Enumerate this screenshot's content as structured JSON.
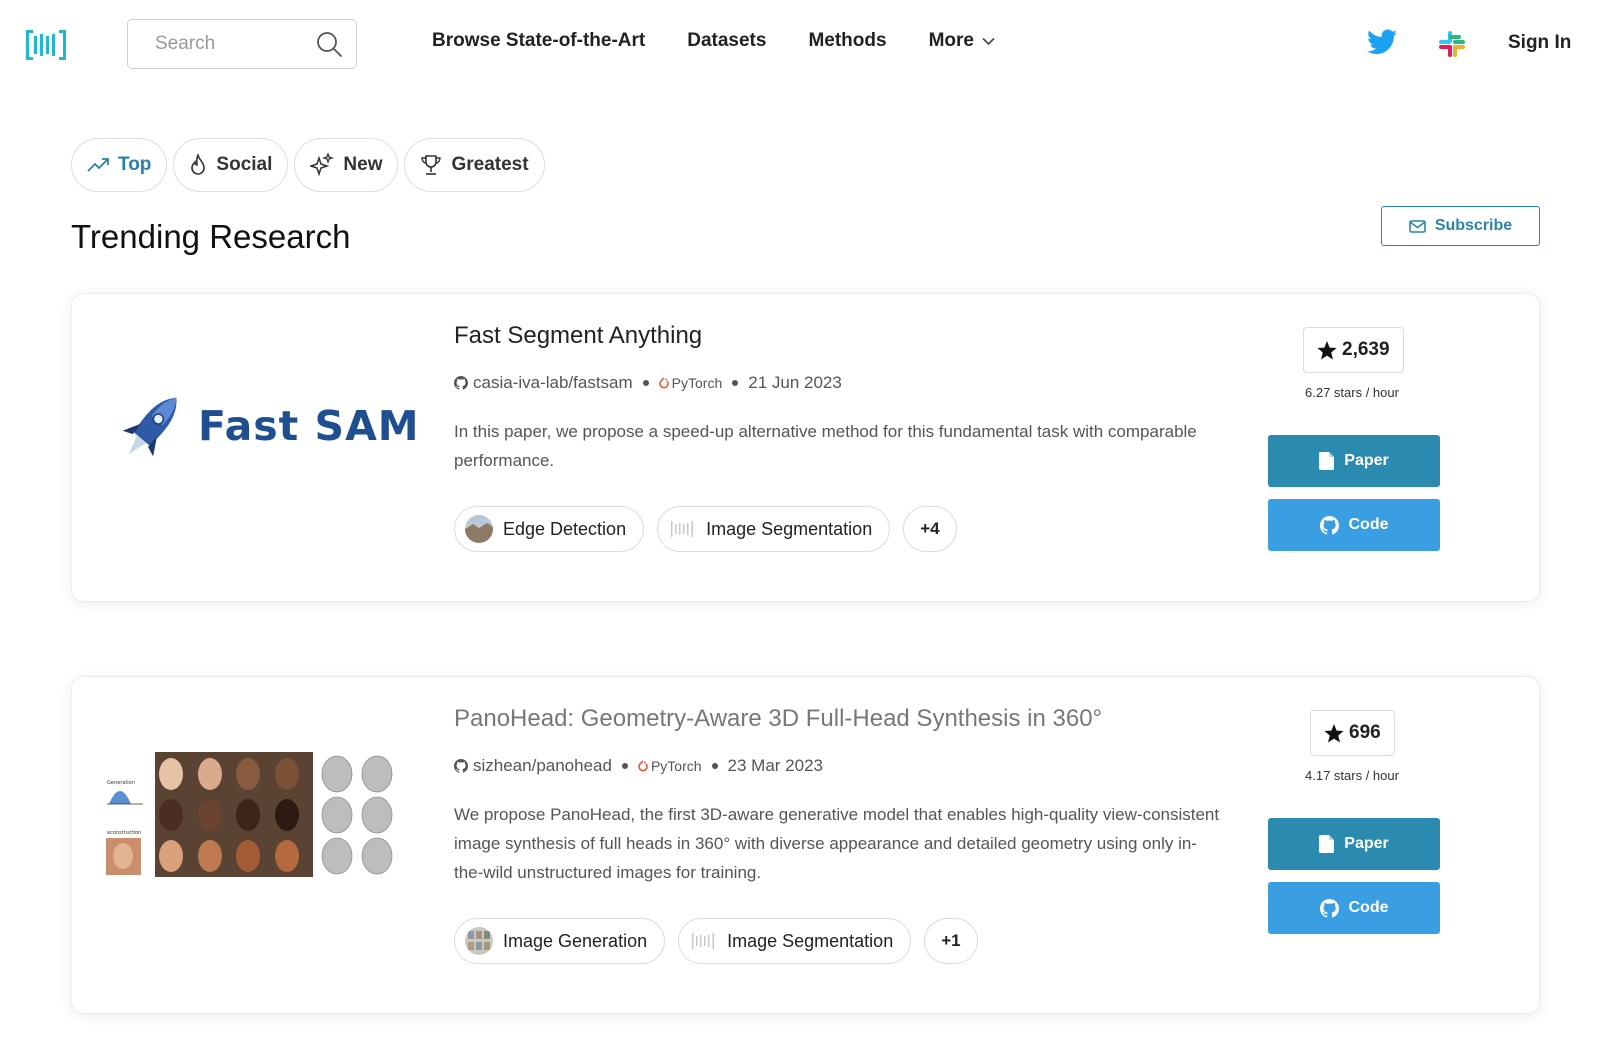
{
  "header": {
    "search_placeholder": "Search",
    "nav": [
      "Browse State-of-the-Art",
      "Datasets",
      "Methods",
      "More"
    ],
    "sign_in": "Sign In"
  },
  "filters": [
    {
      "label": "Top",
      "icon": "trending-icon",
      "active": true
    },
    {
      "label": "Social",
      "icon": "flame-icon",
      "active": false
    },
    {
      "label": "New",
      "icon": "sparkle-icon",
      "active": false
    },
    {
      "label": "Greatest",
      "icon": "trophy-icon",
      "active": false
    }
  ],
  "page_title": "Trending Research",
  "subscribe_label": "Subscribe",
  "papers": [
    {
      "title": "Fast Segment Anything",
      "repo": "casia-iva-lab/fastsam",
      "framework": "PyTorch",
      "date": "21 Jun 2023",
      "abstract": "In this paper, we propose a speed-up alternative method for this fundamental task with comparable performance.",
      "thumbnail_text": "Fast SAM",
      "tags": [
        "Edge Detection",
        "Image Segmentation"
      ],
      "more_tags": "+4",
      "stars": "2,639",
      "rate": "6.27 stars / hour",
      "paper_label": "Paper",
      "code_label": "Code"
    },
    {
      "title": "PanoHead: Geometry-Aware 3D Full-Head Synthesis in 360°",
      "repo": "sizhean/panohead",
      "framework": "PyTorch",
      "date": "23 Mar 2023",
      "abstract": "We propose PanoHead, the first 3D-aware generative model that enables high-quality view-consistent image synthesis of full heads in 360° with diverse appearance and detailed geometry using only in-the-wild unstructured images for training.",
      "tags": [
        "Image Generation",
        "Image Segmentation"
      ],
      "more_tags": "+1",
      "stars": "696",
      "rate": "4.17 stars / hour",
      "paper_label": "Paper",
      "code_label": "Code"
    }
  ],
  "colors": {
    "accent": "#2a86a8",
    "paper_button": "#2b8ab0",
    "code_button": "#3a9ee3",
    "active_tab": "#2a7fb0",
    "logo": "#21b8cf"
  }
}
